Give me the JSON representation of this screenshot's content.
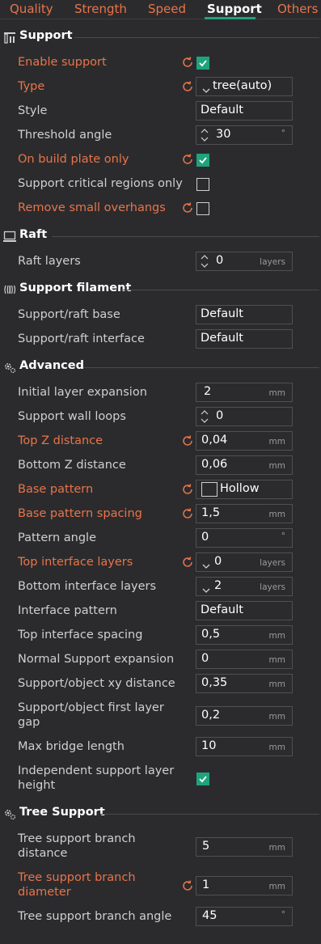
{
  "tabs": [
    {
      "label": "Quality",
      "active": false
    },
    {
      "label": "Strength",
      "active": false
    },
    {
      "label": "Speed",
      "active": false
    },
    {
      "label": "Support",
      "active": true
    },
    {
      "label": "Others",
      "active": false
    }
  ],
  "colors": {
    "accent_orange": "#e8744a",
    "accent_green": "#1fa37b",
    "background": "#2b2b2d"
  },
  "sections": {
    "support": {
      "title": "Support",
      "icon": "support-icon"
    },
    "raft": {
      "title": "Raft",
      "icon": "raft-icon"
    },
    "filament": {
      "title": "Support filament",
      "icon": "filament-icon"
    },
    "advanced": {
      "title": "Advanced",
      "icon": "gear-icon"
    },
    "tree": {
      "title": "Tree Support",
      "icon": "gear-icon"
    }
  },
  "settings": {
    "enable_support": {
      "label": "Enable support",
      "checked": true
    },
    "type": {
      "label": "Type",
      "value": "tree(auto)"
    },
    "style": {
      "label": "Style",
      "value": "Default"
    },
    "threshold_angle": {
      "label": "Threshold angle",
      "value": "30",
      "unit": "°"
    },
    "on_build_plate": {
      "label": "On build plate only",
      "checked": true
    },
    "critical_regions": {
      "label": "Support critical regions only",
      "checked": false
    },
    "remove_small": {
      "label": "Remove small overhangs",
      "checked": false
    },
    "raft_layers": {
      "label": "Raft layers",
      "value": "0",
      "unit": "layers"
    },
    "raft_base": {
      "label": "Support/raft base",
      "value": "Default"
    },
    "raft_interface": {
      "label": "Support/raft interface",
      "value": "Default"
    },
    "initial_expansion": {
      "label": "Initial layer expansion",
      "value": "2",
      "unit": "mm"
    },
    "wall_loops": {
      "label": "Support wall loops",
      "value": "0"
    },
    "top_z": {
      "label": "Top Z distance",
      "value": "0,04",
      "unit": "mm"
    },
    "bottom_z": {
      "label": "Bottom Z distance",
      "value": "0,06",
      "unit": "mm"
    },
    "base_pattern": {
      "label": "Base pattern",
      "value": "Hollow"
    },
    "base_spacing": {
      "label": "Base pattern spacing",
      "value": "1,5",
      "unit": "mm"
    },
    "pattern_angle": {
      "label": "Pattern angle",
      "value": "0",
      "unit": "°"
    },
    "top_interface": {
      "label": "Top interface layers",
      "value": "0",
      "unit": "layers"
    },
    "bottom_interface": {
      "label": "Bottom interface layers",
      "value": "2",
      "unit": "layers"
    },
    "interface_pattern": {
      "label": "Interface pattern",
      "value": "Default"
    },
    "top_interface_spacing": {
      "label": "Top interface spacing",
      "value": "0,5",
      "unit": "mm"
    },
    "normal_expansion": {
      "label": "Normal Support expansion",
      "value": "0",
      "unit": "mm"
    },
    "xy_distance": {
      "label": "Support/object xy distance",
      "value": "0,35",
      "unit": "mm"
    },
    "first_layer_gap": {
      "label_line1": "Support/object first layer",
      "label_line2": "gap",
      "value": "0,2",
      "unit": "mm"
    },
    "max_bridge": {
      "label": "Max bridge length",
      "value": "10",
      "unit": "mm"
    },
    "independent_height": {
      "label_line1": "Independent support layer",
      "label_line2": "height",
      "checked": true
    },
    "branch_distance": {
      "label_line1": "Tree support branch",
      "label_line2": "distance",
      "value": "5",
      "unit": "mm"
    },
    "branch_diameter": {
      "label_line1": "Tree support branch",
      "label_line2": "diameter",
      "value": "1",
      "unit": "mm"
    },
    "branch_angle": {
      "label": "Tree support branch angle",
      "value": "45",
      "unit": "°"
    }
  }
}
